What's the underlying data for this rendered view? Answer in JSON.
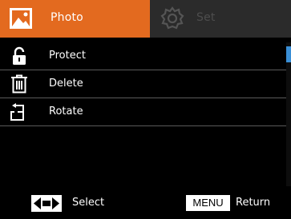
{
  "tabs": {
    "photo": {
      "label": "Photo",
      "icon": "photo-icon",
      "active": true
    },
    "set": {
      "label": "Set",
      "icon": "gear-icon",
      "active": false
    }
  },
  "menu": {
    "items": [
      {
        "label": "Protect",
        "icon": "unlock-icon"
      },
      {
        "label": "Delete",
        "icon": "trash-icon"
      },
      {
        "label": "Rotate",
        "icon": "rotate-icon"
      }
    ]
  },
  "footer": {
    "select_label": "Select",
    "menu_key": "MENU",
    "return_label": "Return",
    "nav_icon": "left-right-arrows-icon"
  },
  "colors": {
    "accent": "#e36a1f",
    "tab_inactive": "#2b2b2b",
    "scroll_thumb": "#3a8fd6"
  }
}
